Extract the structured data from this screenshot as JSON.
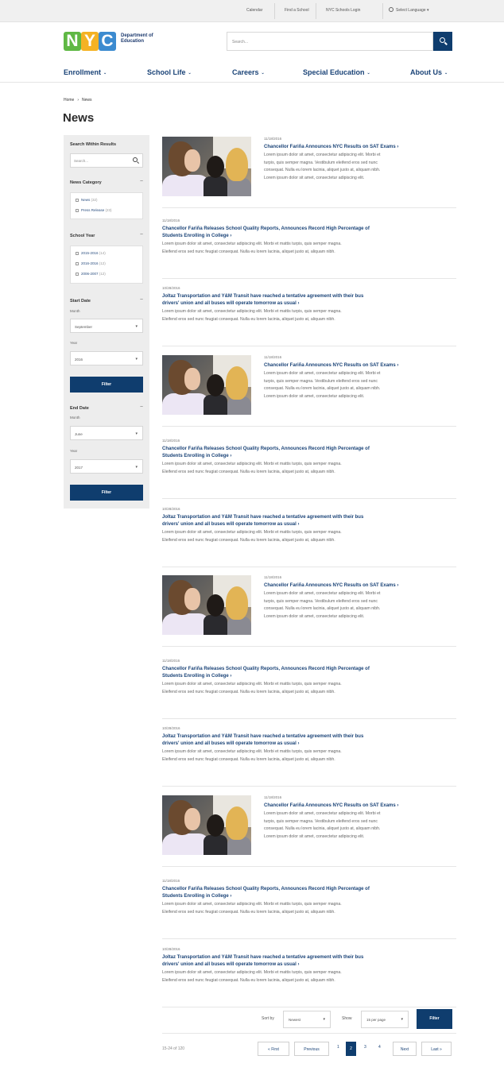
{
  "utility": {
    "links": [
      "Calendar",
      "Find a School",
      "NYC Schools Login"
    ],
    "language": "Select Language"
  },
  "logo": {
    "letters": [
      "N",
      "Y",
      "C"
    ],
    "dept": "Department of Education"
  },
  "search": {
    "placeholder": "Search..."
  },
  "nav": {
    "items": [
      "Enrollment",
      "School Life",
      "Careers",
      "Special Education",
      "About Us"
    ]
  },
  "breadcrumb": [
    "Home",
    "News"
  ],
  "page_title": "News",
  "sidebar": {
    "search_heading": "Search Within Results",
    "search_placeholder": "Search...",
    "category_heading": "News Category",
    "categories": [
      {
        "label": "News",
        "count": "(32)"
      },
      {
        "label": "Press Release",
        "count": "(23)"
      }
    ],
    "year_heading": "School Year",
    "years": [
      {
        "label": "2015-2016",
        "count": "(14)"
      },
      {
        "label": "2016-2016",
        "count": "(12)"
      },
      {
        "label": "2006-2007",
        "count": "(12)"
      }
    ],
    "start_heading": "Start Date",
    "month_label": "Month",
    "year_label": "Year",
    "start_month": "September",
    "start_year": "2016",
    "end_heading": "End Date",
    "end_month": "June",
    "end_year": "2017",
    "filter_label": "Filter",
    "toggle": "−"
  },
  "articles": [
    {
      "date": "11/18/2016",
      "title": "Chancellor Fariña Announces NYC Results on SAT Exams ›",
      "body": [
        "Lorem ipsum dolor sit amet, consectetur adipiscing elit. Morbi et",
        "turpis, quis semper magna. Vestibulum eleifend eros sed nunc",
        "consequat. Nulla eu lorem lacinia, aliquet justo at, aliquam nibh.",
        "Lorem ipsum dolor sit amet, consectetur adipiscing elit."
      ]
    },
    {
      "date": "11/18/2016",
      "title": [
        "Chancellor Fariña Releases School Quality Reports, Announces Record High Percentage of",
        "Students Enrolling in College ›"
      ],
      "body": [
        "Lorem ipsum dolor sit amet, consectetur adipiscing elit. Morbi et mattis turpis, quis semper magna.",
        "Eleifend eros sed nunc feugiat consequat. Nulla eu lorem lacinia, aliquet justo at, aliquam nibh."
      ]
    },
    {
      "date": "10/28/2016",
      "title": [
        "Joltaz Transportation and Y&M Transit have reached a tentative agreement with their bus",
        "drivers' union and all buses will operate tomorrow as usual ›"
      ],
      "body": [
        "Lorem ipsum dolor sit amet, consectetur adipiscing elit. Morbi et mattis turpis, quis semper magna.",
        "Eleifend eros sed nunc feugiat consequat. Nulla eu lorem lacinia, aliquet justo at, aliquam nibh."
      ]
    },
    {
      "date": "11/18/2016",
      "title": "Chancellor Fariña Announces NYC Results on SAT Exams ›",
      "body": [
        "Lorem ipsum dolor sit amet, consectetur adipiscing elit. Morbi et",
        "turpis, quis semper magna. Vestibulum eleifend eros sed nunc",
        "consequat. Nulla eu lorem lacinia, aliquet justo at, aliquam nibh.",
        "Lorem ipsum dolor sit amet, consectetur adipiscing elit."
      ]
    },
    {
      "date": "11/18/2016",
      "title": [
        "Chancellor Fariña Releases School Quality Reports, Announces Record High Percentage of",
        "Students Enrolling in College ›"
      ],
      "body": [
        "Lorem ipsum dolor sit amet, consectetur adipiscing elit. Morbi et mattis turpis, quis semper magna.",
        "Eleifend eros sed nunc feugiat consequat. Nulla eu lorem lacinia, aliquet justo at, aliquam nibh."
      ]
    },
    {
      "date": "10/28/2016",
      "title": [
        "Joltaz Transportation and Y&M Transit have reached a tentative agreement with their bus",
        "drivers' union and all buses will operate tomorrow as usual ›"
      ],
      "body": [
        "Lorem ipsum dolor sit amet, consectetur adipiscing elit. Morbi et mattis turpis, quis semper magna.",
        "Eleifend eros sed nunc feugiat consequat. Nulla eu lorem lacinia, aliquet justo at, aliquam nibh."
      ]
    },
    {
      "date": "11/18/2016",
      "title": "Chancellor Fariña Announces NYC Results on SAT Exams ›",
      "body": [
        "Lorem ipsum dolor sit amet, consectetur adipiscing elit. Morbi et",
        "turpis, quis semper magna. Vestibulum eleifend eros sed nunc",
        "consequat. Nulla eu lorem lacinia, aliquet justo at, aliquam nibh.",
        "Lorem ipsum dolor sit amet, consectetur adipiscing elit."
      ]
    },
    {
      "date": "11/18/2016",
      "title": [
        "Chancellor Fariña Releases School Quality Reports, Announces Record High Percentage of",
        "Students Enrolling in College ›"
      ],
      "body": [
        "Lorem ipsum dolor sit amet, consectetur adipiscing elit. Morbi et mattis turpis, quis semper magna.",
        "Eleifend eros sed nunc feugiat consequat. Nulla eu lorem lacinia, aliquet justo at, aliquam nibh."
      ]
    },
    {
      "date": "10/28/2016",
      "title": [
        "Joltaz Transportation and Y&M Transit have reached a tentative agreement with their bus",
        "drivers' union and all buses will operate tomorrow as usual ›"
      ],
      "body": [
        "Lorem ipsum dolor sit amet, consectetur adipiscing elit. Morbi et mattis turpis, quis semper magna.",
        "Eleifend eros sed nunc feugiat consequat. Nulla eu lorem lacinia, aliquet justo at, aliquam nibh."
      ]
    },
    {
      "date": "11/18/2016",
      "title": "Chancellor Fariña Announces NYC Results on SAT Exams ›",
      "body": [
        "Lorem ipsum dolor sit amet, consectetur adipiscing elit. Morbi et",
        "turpis, quis semper magna. Vestibulum eleifend eros sed nunc",
        "consequat. Nulla eu lorem lacinia, aliquet justo at, aliquam nibh.",
        "Lorem ipsum dolor sit amet, consectetur adipiscing elit."
      ]
    },
    {
      "date": "11/18/2016",
      "title": [
        "Chancellor Fariña Releases School Quality Reports, Announces Record High Percentage of",
        "Students Enrolling in College ›"
      ],
      "body": [
        "Lorem ipsum dolor sit amet, consectetur adipiscing elit. Morbi et mattis turpis, quis semper magna.",
        "Eleifend eros sed nunc feugiat consequat. Nulla eu lorem lacinia, aliquet justo at, aliquam nibh."
      ]
    },
    {
      "date": "10/28/2016",
      "title": [
        "Joltaz Transportation and Y&M Transit have reached a tentative agreement with their bus",
        "drivers' union and all buses will operate tomorrow as usual ›"
      ],
      "body": [
        "Lorem ipsum dolor sit amet, consectetur adipiscing elit. Morbi et mattis turpis, quis semper magna.",
        "Eleifend eros sed nunc feugiat consequat. Nulla eu lorem lacinia, aliquet justo at, aliquam nibh."
      ]
    }
  ],
  "controls": {
    "sort_label": "Sort by",
    "sort_value": "Newest",
    "show_label": "Show",
    "show_value": "15 per page",
    "filter_label": "Filter"
  },
  "pager": {
    "results": "15-24 of 120",
    "first": "« First",
    "previous": "Previous",
    "pages": [
      "1",
      "2",
      "3",
      "4"
    ],
    "current": "2",
    "next": "Next",
    "last": "Last »"
  },
  "colors": {
    "navy": "#0f3d6e",
    "link": "#1a4377",
    "sidebar_bg": "#ededed"
  }
}
